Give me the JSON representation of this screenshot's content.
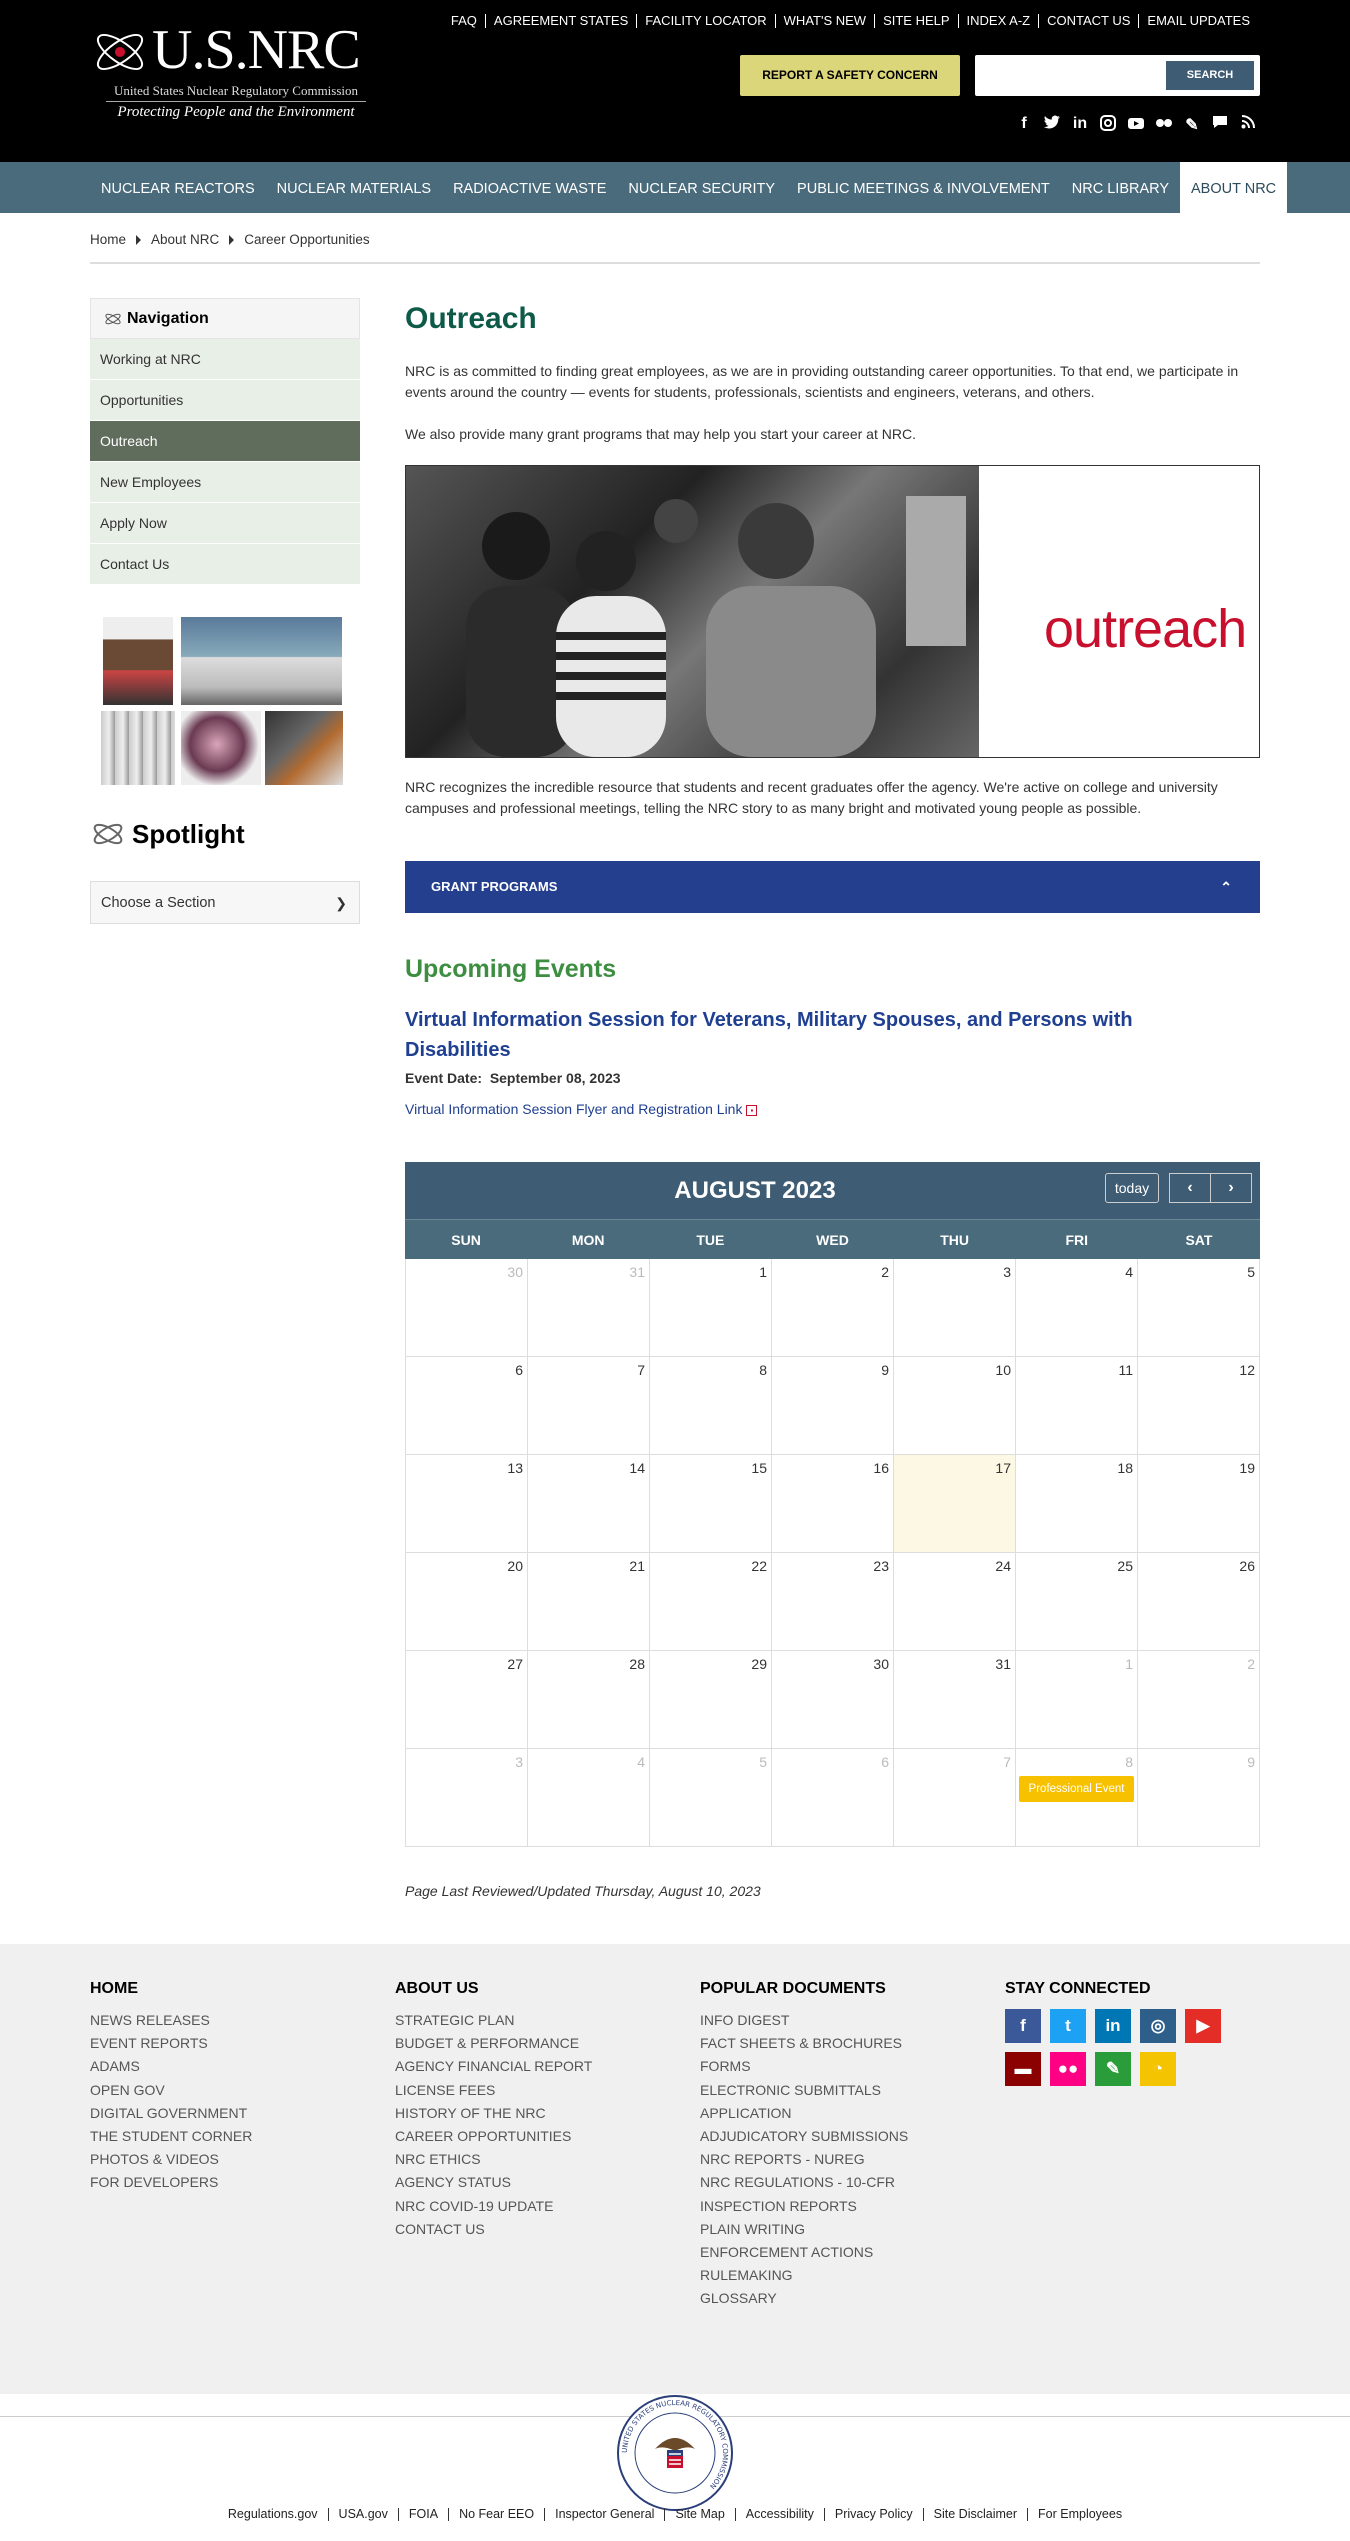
{
  "header": {
    "logo_title": "U.S.NRC",
    "logo_subtitle": "United States Nuclear Regulatory Commission",
    "logo_tagline": "Protecting People and the Environment",
    "top_links": [
      "FAQ",
      "AGREEMENT STATES",
      "FACILITY LOCATOR",
      "WHAT'S NEW",
      "SITE HELP",
      "INDEX A-Z",
      "CONTACT US",
      "EMAIL UPDATES"
    ],
    "report_button": "REPORT A SAFETY CONCERN",
    "search_placeholder": "",
    "search_button": "SEARCH",
    "social_icons": [
      "facebook-icon",
      "twitter-icon",
      "linkedin-icon",
      "instagram-icon",
      "youtube-icon",
      "flickr-icon",
      "blog-icon",
      "chat-icon",
      "rss-icon"
    ]
  },
  "main_nav": [
    "NUCLEAR REACTORS",
    "NUCLEAR MATERIALS",
    "RADIOACTIVE WASTE",
    "NUCLEAR SECURITY",
    "PUBLIC MEETINGS & INVOLVEMENT",
    "NRC LIBRARY",
    "ABOUT NRC"
  ],
  "main_nav_active": "ABOUT NRC",
  "breadcrumb": [
    "Home",
    "About NRC",
    "Career Opportunities"
  ],
  "sidebar": {
    "heading": "Navigation",
    "items": [
      "Working at NRC",
      "Opportunities",
      "Outreach",
      "New Employees",
      "Apply Now",
      "Contact Us"
    ],
    "active": "Outreach",
    "spotlight": "Spotlight",
    "choose_section": "Choose a Section"
  },
  "main": {
    "title": "Outreach",
    "intro": "NRC is as committed to finding great employees, as we are in providing outstanding career opportunities. To that end, we participate in events around the country — events for students, professionals, scientists and engineers, veterans, and others.",
    "grants_text": "We also provide many grant programs that may help you start your career at NRC.",
    "hero_word": "outreach",
    "resource_text": "NRC recognizes the incredible resource that students and recent graduates offer the agency. We're active on college and university campuses and professional meetings, telling the NRC story to as many bright and motivated young people as possible.",
    "grant_programs": "GRANT PROGRAMS",
    "upcoming_events": "Upcoming Events",
    "event_title": "Virtual Information Session for Veterans, Military Spouses, and Persons with Disabilities",
    "event_date_label": "Event Date:",
    "event_date": "September 08, 2023",
    "event_link": "Virtual Information Session Flyer and Registration Link",
    "last_updated": "Page Last Reviewed/Updated Thursday, August 10, 2023"
  },
  "calendar": {
    "title": "AUGUST 2023",
    "today_button": "today",
    "prev": "‹",
    "next": "›",
    "weekdays": [
      "SUN",
      "MON",
      "TUE",
      "WED",
      "THU",
      "FRI",
      "SAT"
    ],
    "weeks": [
      [
        "30",
        "31",
        "1",
        "2",
        "3",
        "4",
        "5"
      ],
      [
        "6",
        "7",
        "8",
        "9",
        "10",
        "11",
        "12"
      ],
      [
        "13",
        "14",
        "15",
        "16",
        "17",
        "18",
        "19"
      ],
      [
        "20",
        "21",
        "22",
        "23",
        "24",
        "25",
        "26"
      ],
      [
        "27",
        "28",
        "29",
        "30",
        "31",
        "1",
        "2"
      ],
      [
        "3",
        "4",
        "5",
        "6",
        "7",
        "8",
        "9"
      ]
    ],
    "today_date": "17",
    "event_label": "Professional Event",
    "event_day": "8"
  },
  "footer": {
    "home": {
      "heading": "HOME",
      "links": [
        "NEWS RELEASES",
        "EVENT REPORTS",
        "ADAMS",
        "OPEN GOV",
        "DIGITAL GOVERNMENT",
        "THE STUDENT CORNER",
        "PHOTOS & VIDEOS",
        "FOR DEVELOPERS"
      ]
    },
    "about": {
      "heading": "ABOUT US",
      "links": [
        "STRATEGIC PLAN",
        "BUDGET & PERFORMANCE",
        "AGENCY FINANCIAL REPORT",
        "LICENSE FEES",
        "HISTORY OF THE NRC",
        "CAREER OPPORTUNITIES",
        "NRC ETHICS",
        "AGENCY STATUS",
        "NRC COVID-19 UPDATE",
        "CONTACT US"
      ]
    },
    "popular": {
      "heading": "POPULAR DOCUMENTS",
      "links": [
        "INFO DIGEST",
        "FACT SHEETS & BROCHURES",
        "FORMS",
        "ELECTRONIC SUBMITTALS",
        "APPLICATION",
        "ADJUDICATORY SUBMISSIONS",
        "NRC REPORTS - NUREG",
        "NRC REGULATIONS - 10-CFR",
        "INSPECTION REPORTS",
        "PLAIN WRITING",
        "ENFORCEMENT ACTIONS",
        "RULEMAKING",
        "GLOSSARY"
      ]
    },
    "stay_connected": "STAY CONNECTED",
    "social": [
      {
        "icon": "facebook-icon",
        "glyph": "f",
        "color": "#3b5998"
      },
      {
        "icon": "twitter-icon",
        "glyph": "t",
        "color": "#1da1f2"
      },
      {
        "icon": "linkedin-icon",
        "glyph": "in",
        "color": "#0077b5"
      },
      {
        "icon": "instagram-icon",
        "glyph": "◎",
        "color": "#2e5f8a"
      },
      {
        "icon": "youtube-icon",
        "glyph": "▶",
        "color": "#e52d27"
      },
      {
        "icon": "chat-icon",
        "glyph": "▬",
        "color": "#8b0000"
      },
      {
        "icon": "flickr-icon",
        "glyph": "●●",
        "color": "#ff0084"
      },
      {
        "icon": "blog-icon",
        "glyph": "✎",
        "color": "#2a9d3a"
      },
      {
        "icon": "rss-icon",
        "glyph": "◔",
        "color": "#f5c400"
      }
    ],
    "bottom_links": [
      "Regulations.gov",
      "USA.gov",
      "FOIA",
      "No Fear EEO",
      "Inspector General",
      "Site Map",
      "Accessibility",
      "Privacy Policy",
      "Site Disclaimer",
      "For Employees"
    ],
    "seal_text": "UNITED STATES NUCLEAR REGULATORY COMMISSION"
  }
}
